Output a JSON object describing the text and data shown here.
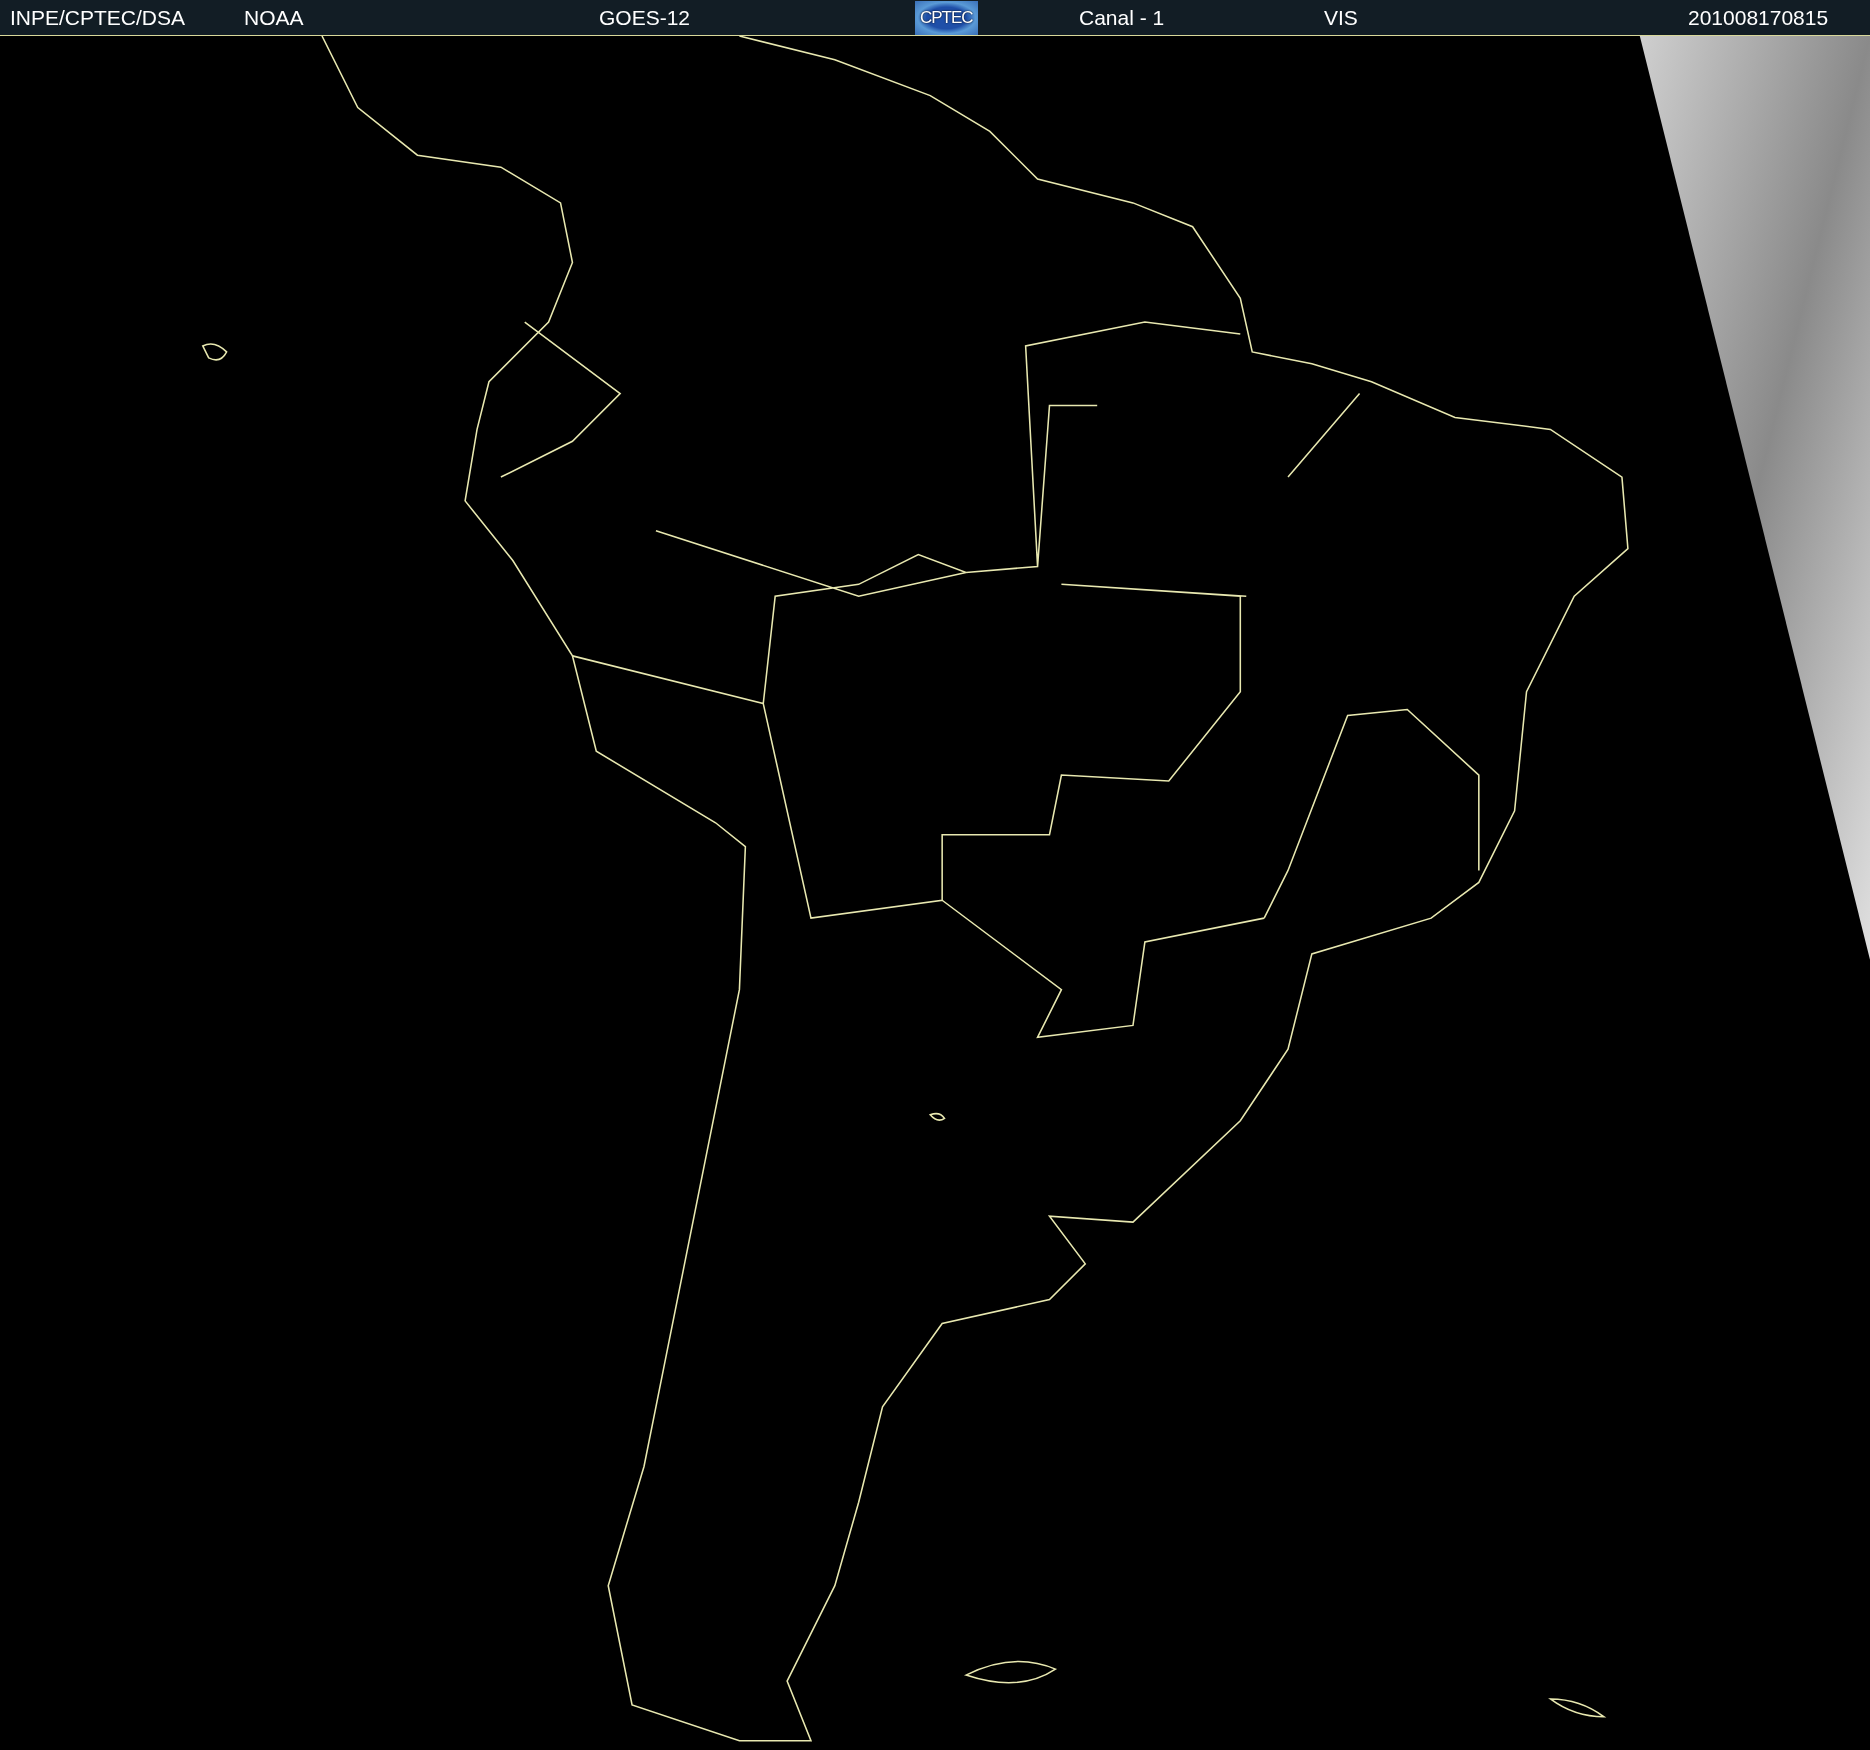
{
  "header": {
    "items": [
      {
        "kind": "text",
        "text": "INPE/CPTEC/DSA"
      },
      {
        "kind": "text",
        "text": "NOAA"
      },
      {
        "kind": "text",
        "text": "GOES-12"
      },
      {
        "kind": "logo",
        "text": "CPTEC"
      },
      {
        "kind": "text",
        "text": "Canal - 1"
      },
      {
        "kind": "text",
        "text": "VIS"
      },
      {
        "kind": "text",
        "text": "201008170815"
      }
    ]
  }
}
